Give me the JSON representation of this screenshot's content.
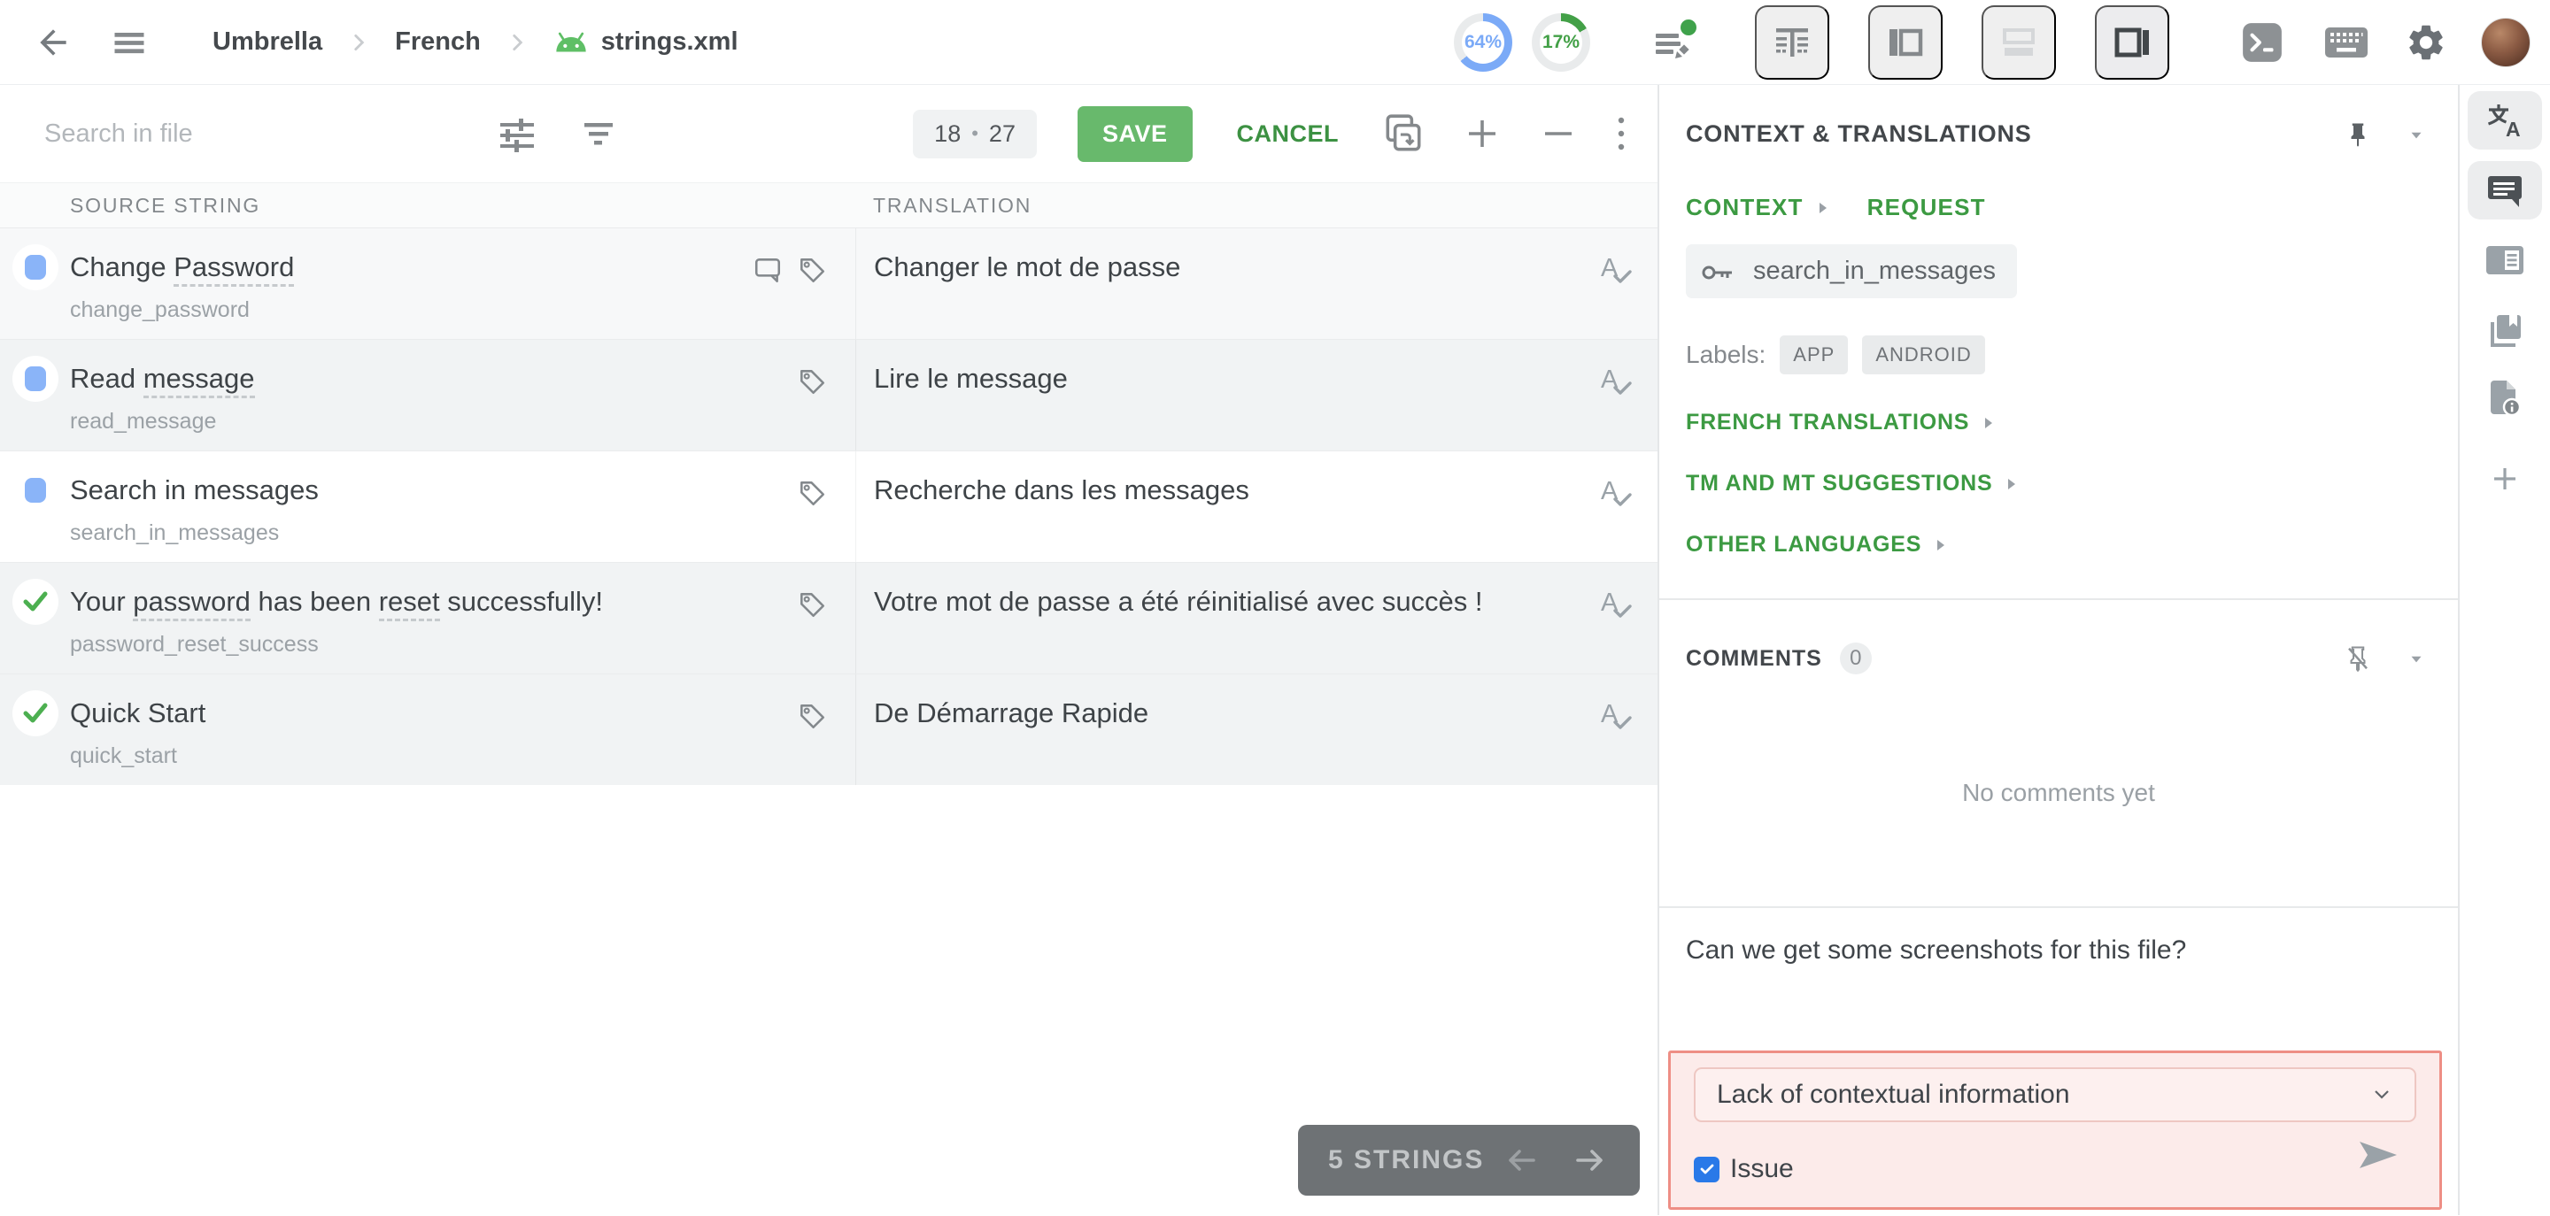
{
  "topbar": {
    "breadcrumb": {
      "project": "Umbrella",
      "language": "French",
      "file": "strings.xml"
    },
    "progress": [
      {
        "value": "64%",
        "pct": 64,
        "color": "#7baaf7"
      },
      {
        "value": "17%",
        "pct": 17,
        "color": "#43a047"
      }
    ]
  },
  "toolbar": {
    "search_placeholder": "Search in file",
    "counter": {
      "current": "18",
      "total": "27"
    },
    "save_label": "SAVE",
    "cancel_label": "CANCEL"
  },
  "table": {
    "source_header": "SOURCE STRING",
    "translation_header": "TRANSLATION",
    "rows": [
      {
        "source": [
          {
            "t": "Change "
          },
          {
            "t": "Password",
            "term": true
          }
        ],
        "key": "change_password",
        "translation": "Changer le mot de passe",
        "status": "translated",
        "bg": "tint",
        "has_comment_icon": true
      },
      {
        "source": [
          {
            "t": "Read "
          },
          {
            "t": "message",
            "term": true
          }
        ],
        "key": "read_message",
        "translation": "Lire le message",
        "status": "translated",
        "bg": "gray",
        "has_comment_icon": false
      },
      {
        "source": [
          {
            "t": "Search in messages"
          }
        ],
        "key": "search_in_messages",
        "translation": "Recherche dans les messages",
        "status": "translated",
        "bg": "selected",
        "has_comment_icon": false
      },
      {
        "source": [
          {
            "t": "Your "
          },
          {
            "t": "password",
            "term": true
          },
          {
            "t": " has been "
          },
          {
            "t": "reset",
            "term": true
          },
          {
            "t": " successfully!"
          }
        ],
        "key": "password_reset_success",
        "translation": "Votre mot de passe a été réinitialisé avec succès !",
        "status": "approved",
        "bg": "gray",
        "has_comment_icon": false
      },
      {
        "source": [
          {
            "t": "Quick Start"
          }
        ],
        "key": "quick_start",
        "translation": "De Démarrage Rapide",
        "status": "approved",
        "bg": "gray",
        "has_comment_icon": false
      }
    ]
  },
  "footer": {
    "strings_count_label": "5 STRINGS"
  },
  "context_panel": {
    "title": "CONTEXT & TRANSLATIONS",
    "tabs": {
      "context": "CONTEXT",
      "request": "REQUEST"
    },
    "string_key": "search_in_messages",
    "labels_caption": "Labels:",
    "labels": [
      "APP",
      "ANDROID"
    ],
    "sections": [
      "FRENCH TRANSLATIONS",
      "TM AND MT SUGGESTIONS",
      "OTHER LANGUAGES"
    ],
    "comments": {
      "title": "COMMENTS",
      "count": "0",
      "empty_text": "No comments yet",
      "draft_text": "Can we get some screenshots for this file?"
    },
    "issue_box": {
      "dropdown_value": "Lack of contextual information",
      "checkbox_label": "Issue",
      "checkbox_checked": true
    }
  },
  "colors": {
    "accent_green": "#3c9a42",
    "save_green": "#68b96c",
    "status_translated_blue": "#8ab4f8",
    "status_approved_green": "#4caf50",
    "issue_border_red": "#ee8e85",
    "issue_bg_pink": "#fcebea",
    "checkbox_blue": "#2979e8"
  },
  "icons": {
    "android_icon": "green android robot head",
    "edits_icon": "list lines with pencil and green notification dot",
    "view_mode_active": "right-panel layout"
  }
}
